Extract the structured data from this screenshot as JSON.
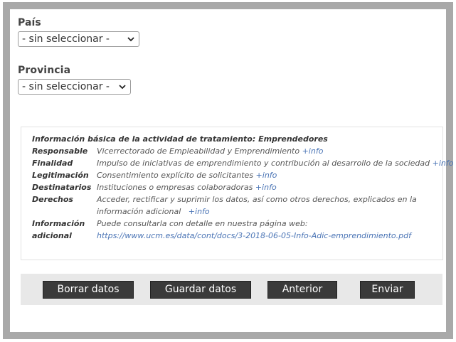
{
  "form": {
    "country": {
      "label": "País",
      "selected": "- sin seleccionar -"
    },
    "province": {
      "label": "Provincia",
      "selected": "- sin seleccionar -"
    }
  },
  "info": {
    "title": "Información básica de la actividad de tratamiento: Emprendedores",
    "rows": [
      {
        "key": "Responsable",
        "text": "Vicerrectorado de Empleabilidad y Emprendimiento ",
        "link": "+info"
      },
      {
        "key": "Finalidad",
        "text": "Impulso de iniciativas de emprendimiento y contribución al desarrollo de la sociedad ",
        "link": "+info"
      },
      {
        "key": "Legitimación",
        "text": "Consentimiento explícito de  solicitantes ",
        "link": "+info"
      },
      {
        "key": "Destinatarios",
        "text": "Instituciones o empresas colaboradoras ",
        "link": "+info"
      },
      {
        "key": "Derechos",
        "text": "Acceder, rectificar y suprimir los datos, así como otros derechos, explicados en la",
        "text2": "información adicional ",
        "link": "+info"
      },
      {
        "key": "Información",
        "key2": "adicional",
        "text": "Puede consultarla con detalle en nuestra página web:",
        "url": "https://www.ucm.es/data/cont/docs/3-2018-06-05-Info-Adic-emprendimiento.pdf"
      }
    ]
  },
  "buttons": {
    "clear": "Borrar datos",
    "save": "Guardar datos",
    "previous": "Anterior",
    "send": "Enviar"
  }
}
